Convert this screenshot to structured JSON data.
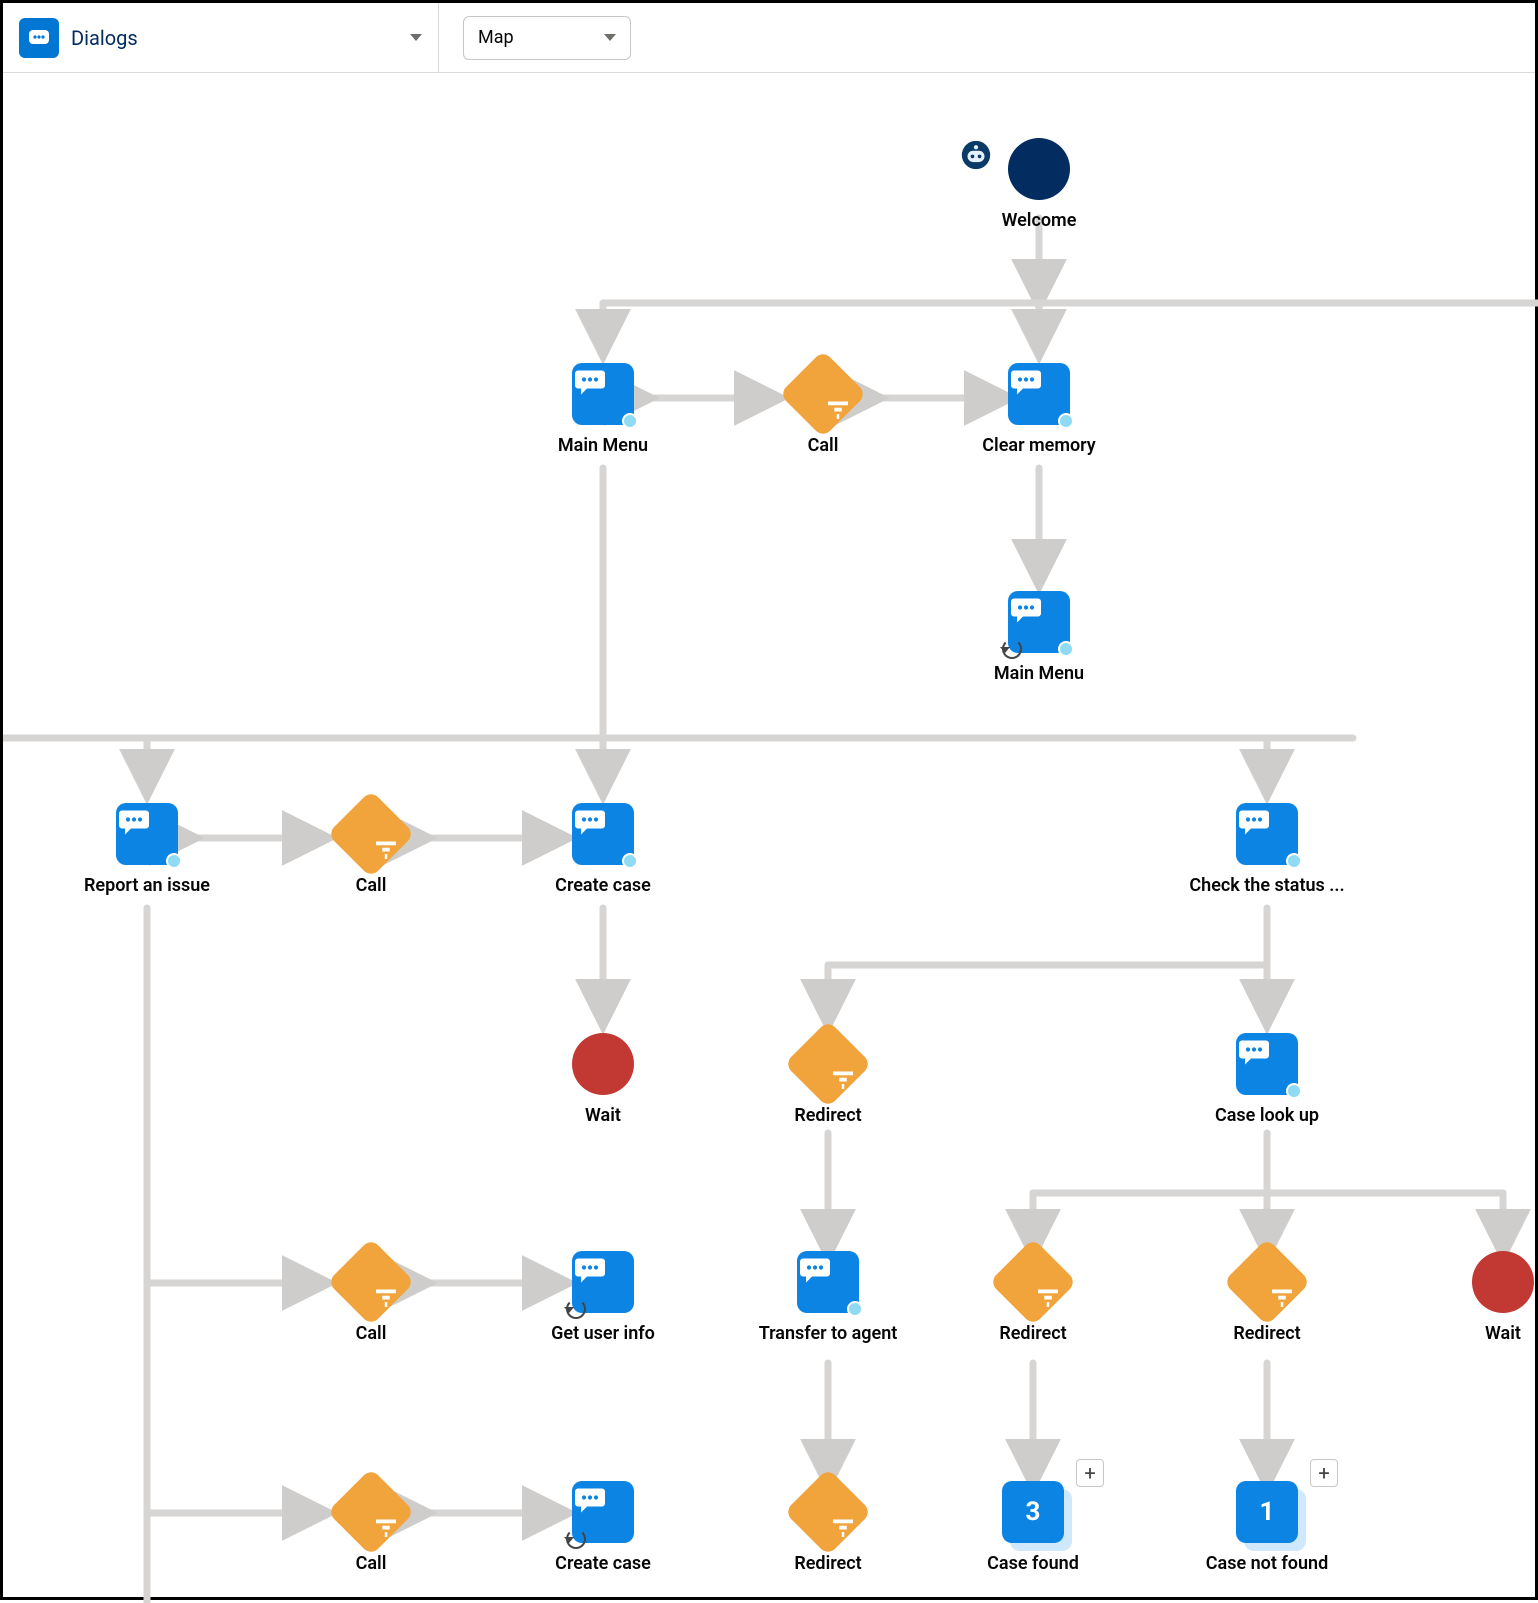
{
  "toolbar": {
    "entity_label": "Dialogs",
    "view_label": "Map"
  },
  "nodes": {
    "welcome": {
      "label": "Welcome"
    },
    "main_menu": {
      "label": "Main Menu"
    },
    "call_top": {
      "label": "Call"
    },
    "clear_memory": {
      "label": "Clear memory"
    },
    "main_menu_ref": {
      "label": "Main Menu"
    },
    "report_issue": {
      "label": "Report an issue"
    },
    "call_mid1": {
      "label": "Call"
    },
    "create_case": {
      "label": "Create case"
    },
    "check_status": {
      "label": "Check the status ..."
    },
    "wait1": {
      "label": "Wait"
    },
    "redirect1": {
      "label": "Redirect"
    },
    "case_lookup": {
      "label": "Case look up"
    },
    "call_mid2": {
      "label": "Call"
    },
    "get_user_info": {
      "label": "Get user info"
    },
    "transfer_agent": {
      "label": "Transfer to agent"
    },
    "redirect2": {
      "label": "Redirect"
    },
    "redirect3": {
      "label": "Redirect"
    },
    "wait2": {
      "label": "Wait"
    },
    "call_bottom": {
      "label": "Call"
    },
    "create_case_ref": {
      "label": "Create case"
    },
    "redirect4": {
      "label": "Redirect"
    },
    "case_found": {
      "label": "Case found",
      "count": "3"
    },
    "case_not_found": {
      "label": "Case not found",
      "count": "1"
    }
  }
}
